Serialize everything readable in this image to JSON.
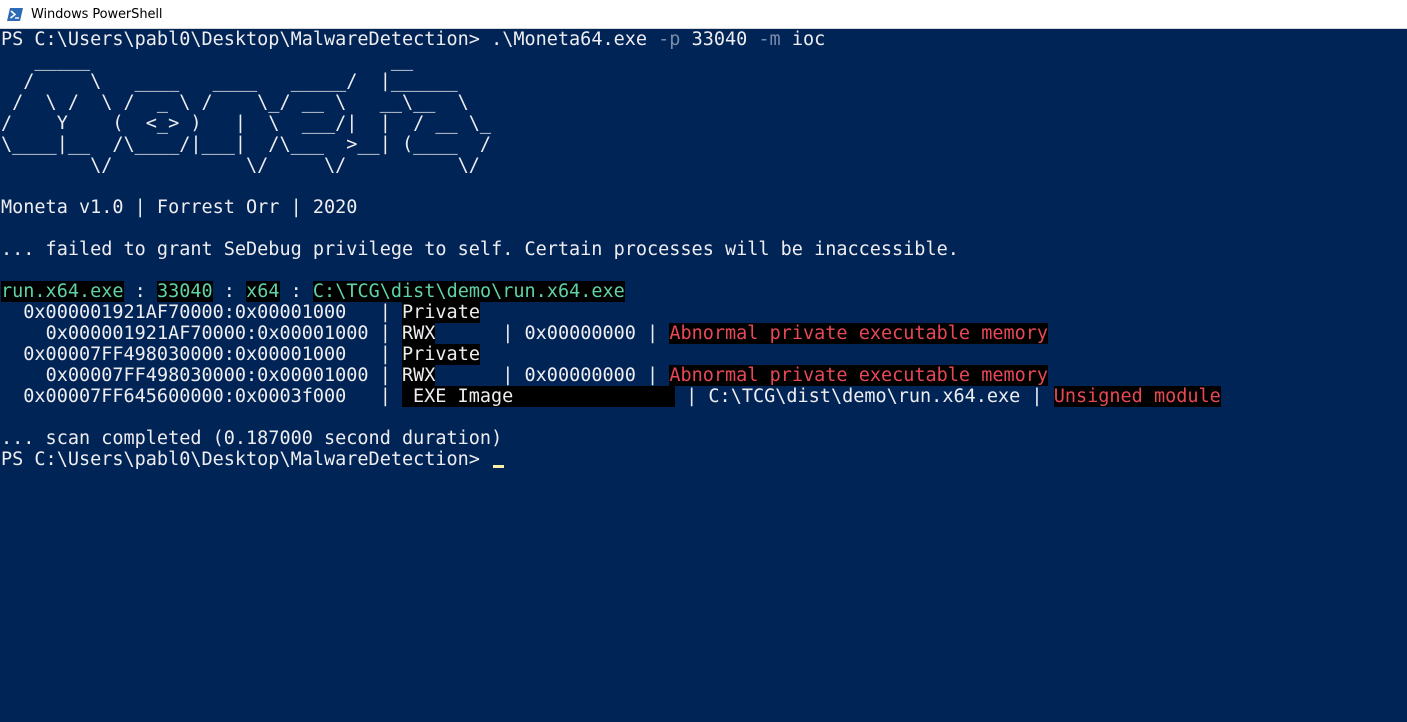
{
  "window": {
    "title": "Windows PowerShell",
    "background": "#012456",
    "icon": "powershell-icon"
  },
  "console": {
    "prompt": "PS C:\\Users\\pabl0\\Desktop\\MalwareDetection>",
    "command": {
      "exe": ".\\Moneta64.exe",
      "flag_p": "-p",
      "pid_arg": "33040",
      "flag_m": "-m",
      "mode_arg": "ioc"
    },
    "banner": [
      "   _____                           __",
      "  /     \\   ____   ____   _____/  |______",
      " /  \\ /  \\ /  _ \\ /    \\_/ __ \\   __\\__  \\",
      "/    Y    (  <_> )   |  \\  ___/|  |  / __ \\_",
      "\\____|__  /\\____/|___|  /\\___  >__| (____  /",
      "        \\/            \\/     \\/          \\/"
    ],
    "version_line": "Moneta v1.0 | Forrest Orr | 2020",
    "warning_line": "... failed to grant SeDebug privilege to self. Certain processes will be inaccessible.",
    "process": {
      "name": "run.x64.exe",
      "pid": "33040",
      "arch": "x64",
      "path": "C:\\TCG\\dist\\demo\\run.x64.exe"
    },
    "regions": [
      {
        "address": "0x000001921AF70000:0x00001000",
        "type": "Private",
        "subregion": {
          "address": "0x000001921AF70000:0x00001000",
          "protect": "RWX",
          "value": "0x00000000",
          "ioc": "Abnormal private executable memory"
        }
      },
      {
        "address": "0x00007FF498030000:0x00001000",
        "type": "Private",
        "subregion": {
          "address": "0x00007FF498030000:0x00001000",
          "protect": "RWX",
          "value": "0x00000000",
          "ioc": "Abnormal private executable memory"
        }
      },
      {
        "address": "0x00007FF645600000:0x0003f000",
        "type": "EXE Image",
        "path": "C:\\TCG\\dist\\demo\\run.x64.exe",
        "ioc": "Unsigned module"
      }
    ],
    "scan_completed": "... scan completed (0.187000 second duration)",
    "colors": {
      "text": "#eeedf0",
      "dim": "#7a8cab",
      "green": "#5fd3a6",
      "red": "#e74856",
      "cursor": "#f9f1a5"
    }
  }
}
